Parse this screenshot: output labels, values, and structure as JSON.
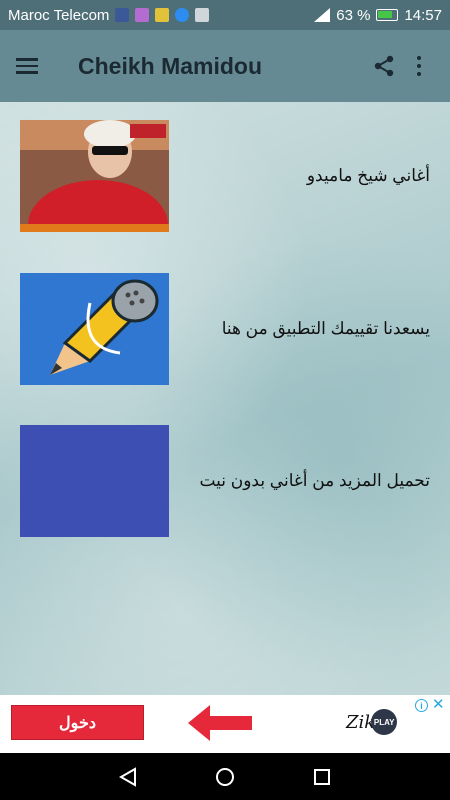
{
  "status": {
    "carrier": "Maroc Telecom",
    "battery": "63 %",
    "time": "14:57",
    "icons": [
      "facebook-icon",
      "instagram-icon",
      "game-icon",
      "messenger-icon",
      "mail-icon"
    ]
  },
  "toolbar": {
    "title": "Cheikh Mamidou",
    "menu_icon": "hamburger-menu-icon",
    "share_icon": "share-icon",
    "more_icon": "more-vert-icon"
  },
  "items": [
    {
      "label": "أغاني شيخ ماميدو",
      "thumb": "singer-photo"
    },
    {
      "label": "يسعدنا تقييمك التطبيق من هنا",
      "thumb": "microphone-pencil-icon"
    },
    {
      "label": "تحميل المزيد من أغاني بدون نيت",
      "thumb": "blue-square"
    }
  ],
  "ad": {
    "button_label": "دخول",
    "logo_text": "Zik",
    "logo_badge": "PLAY",
    "info_icon": "i",
    "close_icon": "✕"
  },
  "colors": {
    "toolbar": "#668a94",
    "status_bar": "#4f6f78",
    "ad_button": "#e5293a",
    "thumb_blue": "#2f77d0",
    "thumb_indigo": "#3e4fb4"
  }
}
